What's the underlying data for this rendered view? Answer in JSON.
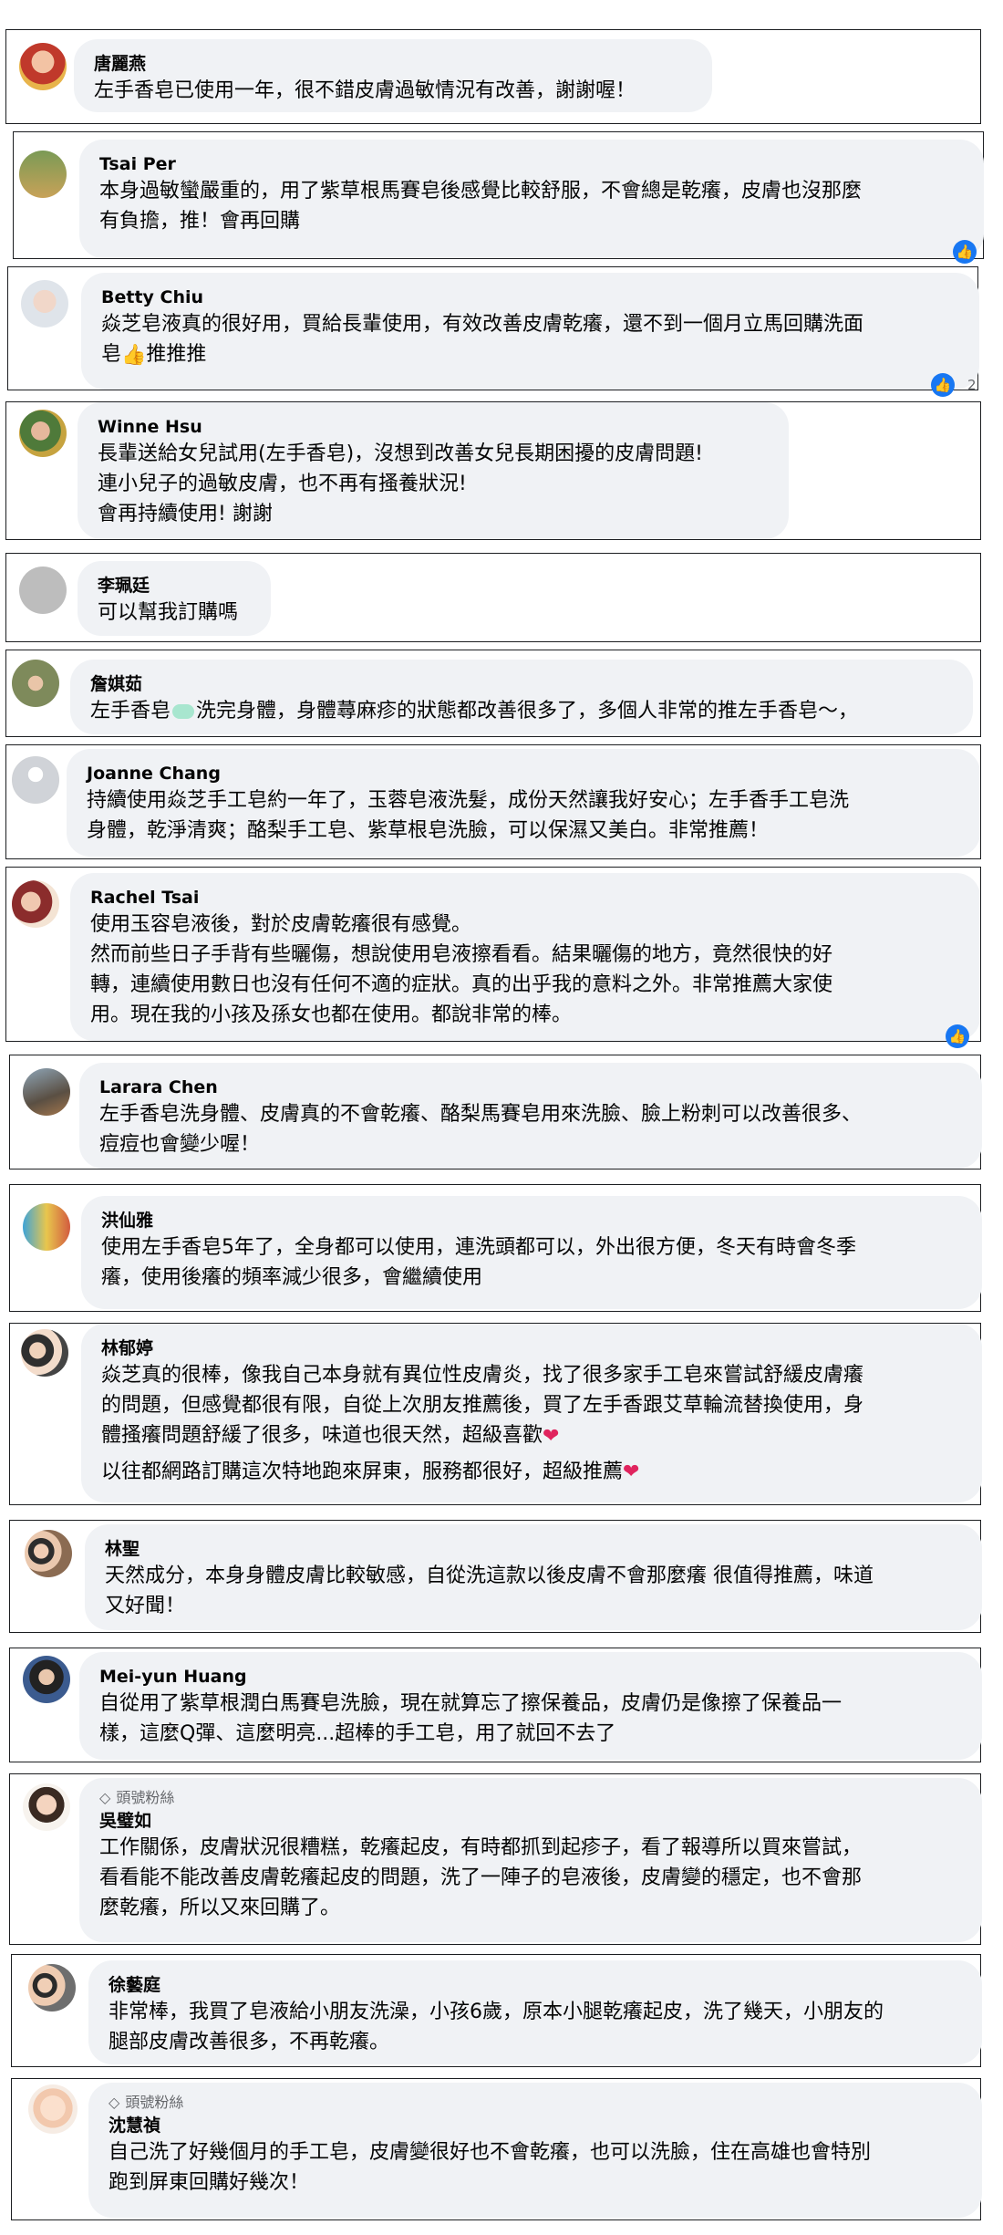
{
  "comments": [
    {
      "name": "唐麗燕",
      "lines": [
        "左手香皂已使用一年，很不錯皮膚過敏情況有改善，謝謝喔！"
      ]
    },
    {
      "name": "Tsai Per",
      "lines": [
        "本身過敏蠻嚴重的，用了紫草根馬賽皂後感覺比較舒服，不會總是乾癢，皮膚也沒那麼",
        "有負擔，推！會再回購"
      ]
    },
    {
      "name": "Betty Chiu",
      "lines": [
        "焱芝皂液真的很好用，買給長輩使用，有效改善皮膚乾癢，還不到一個月立馬回購洗面",
        "皂",
        "推推推"
      ],
      "reaction_count": "2"
    },
    {
      "name": "Winne Hsu",
      "lines": [
        "長輩送給女兒試用(左手香皂)，沒想到改善女兒長期困擾的皮膚問題!",
        "連小兒子的過敏皮膚，也不再有搔養狀況!",
        "會再持續使用! 謝謝"
      ]
    },
    {
      "name": "李珮廷",
      "lines": [
        "可以幫我訂購嗎"
      ]
    },
    {
      "name": "詹娸茹",
      "lines": [
        "左手香皂",
        "洗完身體，身體蕁麻疹的狀態都改善很多了，多個人非常的推左手香皂～，"
      ]
    },
    {
      "name": "Joanne Chang",
      "lines": [
        "持續使用焱芝手工皂約一年了，玉蓉皂液洗髮，成份天然讓我好安心；左手香手工皂洗",
        "身體，乾淨清爽；酪梨手工皂、紫草根皂洗臉，可以保濕又美白。非常推薦！"
      ]
    },
    {
      "name": "Rachel Tsai",
      "lines": [
        "使用玉容皂液後，對於皮膚乾癢很有感覺。",
        "然而前些日子手背有些曬傷，想說使用皂液擦看看。結果曬傷的地方，竟然很快的好",
        "轉，連續使用數日也沒有任何不適的症狀。真的出乎我的意料之外。非常推薦大家使",
        "用。現在我的小孩及孫女也都在使用。都說非常的棒。"
      ]
    },
    {
      "name": "Larara Chen",
      "lines": [
        "左手香皂洗身體、皮膚真的不會乾癢、酪梨馬賽皂用來洗臉、臉上粉刺可以改善很多、",
        "痘痘也會變少喔！"
      ]
    },
    {
      "name": "洪仙雅",
      "lines": [
        "使用左手香皂5年了，全身都可以使用，連洗頭都可以，外出很方便，冬天有時會冬季",
        "癢，使用後癢的頻率減少很多，會繼續使用"
      ]
    },
    {
      "name": "林郁婷",
      "lines": [
        "焱芝真的很棒，像我自己本身就有異位性皮膚炎，找了很多家手工皂來嘗試舒緩皮膚癢",
        "的問題，但感覺都很有限，自從上次朋友推薦後，買了左手香跟艾草輪流替換使用，身",
        "體搔癢問題舒緩了很多，味道也很天然，超級喜歡",
        "以往都網路訂購這次特地跑來屏東，服務都很好，超級推薦"
      ]
    },
    {
      "name": "林聖",
      "lines": [
        "天然成分，本身身體皮膚比較敏感，自從洗這款以後皮膚不會那麼癢 很值得推薦，味道",
        "又好聞！"
      ]
    },
    {
      "name": "Mei-yun Huang",
      "lines": [
        "自從用了紫草根潤白馬賽皂洗臉，現在就算忘了擦保養品，皮膚仍是像擦了保養品一",
        "樣，這麼Q彈、這麼明亮...超棒的手工皂，用了就回不去了"
      ]
    },
    {
      "name": "吳璧如",
      "badge": "頭號粉絲",
      "lines": [
        "工作關係，皮膚狀況很糟糕，乾癢起皮，有時都抓到起疹子，看了報導所以買來嘗試，",
        "看看能不能改善皮膚乾癢起皮的問題，洗了一陣子的皂液後，皮膚變的穩定，也不會那",
        "麼乾癢，所以又來回購了。"
      ]
    },
    {
      "name": "徐藝庭",
      "lines": [
        "非常棒，我買了皂液給小朋友洗澡，小孩6歲，原本小腿乾癢起皮，洗了幾天，小朋友的",
        "腿部皮膚改善很多，不再乾癢。"
      ]
    },
    {
      "name": "沈慧禎",
      "badge": "頭號粉絲",
      "lines": [
        "自己洗了好幾個月的手工皂，皮膚變很好也不會乾癢，也可以洗臉，住在高雄也會特別",
        "跑到屏東回購好幾次！"
      ]
    }
  ],
  "icons": {
    "like": "thumbs-up-icon",
    "badge": "diamond-icon"
  },
  "colors": {
    "bubble": "#f0f2f5",
    "like": "#1877f2",
    "border": "#1c1e21"
  }
}
